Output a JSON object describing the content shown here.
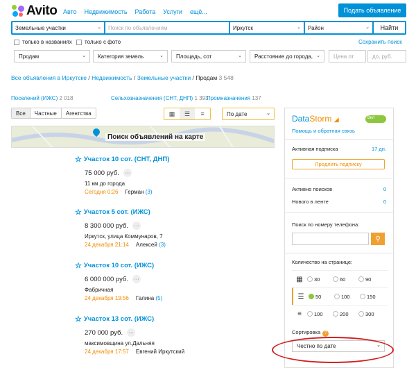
{
  "header": {
    "logo": "Avito",
    "nav": [
      "Авто",
      "Недвижимость",
      "Работа",
      "Услуги",
      "ещё..."
    ],
    "post_button": "Подать объявление"
  },
  "search": {
    "category": "Земельные участки",
    "query_placeholder": "Поиск по объявлениям",
    "city": "Иркутск",
    "district": "Район",
    "find_button": "Найти"
  },
  "checks": {
    "titles_only": "только в названиях",
    "with_photo": "только с фото",
    "save_search": "Сохранить поиск"
  },
  "filters": {
    "deal": "Продам",
    "land_category": "Категория земель",
    "area": "Площадь, сот",
    "distance": "Расстояние до города,",
    "price_from": "Цена от",
    "price_to": "до, руб."
  },
  "breadcrumb": {
    "p1": "Все объявления в Иркутске",
    "p2": "Недвижимость",
    "p3": "Земельные участки",
    "current": "Продам",
    "count": "3 548"
  },
  "categories": [
    {
      "label": "Поселений (ИЖС)",
      "count": "2 018"
    },
    {
      "label": "Сельхозназначения (СНТ, ДНП)",
      "count": "1 393"
    },
    {
      "label": "Промназначения",
      "count": "137"
    }
  ],
  "tabs": [
    "Все",
    "Частные",
    "Агентства"
  ],
  "sort": "По дате",
  "map_label": "Поиск объявлений на карте",
  "listings": [
    {
      "title": "Участок 10 сот. (СНТ, ДНП)",
      "price": "75 000 руб.",
      "addr": "11 км до города",
      "date": "Сегодня 0:26",
      "seller": "Герман",
      "n": "(3)"
    },
    {
      "title": "Участок 5 сот. (ИЖС)",
      "price": "8 300 000 руб.",
      "addr": "Иркутск, улица Коммунаров, 7",
      "date": "24 декабря 21:14",
      "seller": "Алексей",
      "n": "(3)"
    },
    {
      "title": "Участок 10 сот. (ИЖС)",
      "price": "6 000 000 руб.",
      "addr": "Фабричная",
      "date": "24 декабря 19:56",
      "seller": "Галина",
      "n": "(5)"
    },
    {
      "title": "Участок 13 сот. (ИЖС)",
      "price": "270 000 руб.",
      "addr": "максимовщина ул.Дальняя",
      "date": "24 декабря 17:57",
      "seller": "Евгений Иркутский",
      "n": ""
    }
  ],
  "panel": {
    "brand_a": "Data",
    "brand_b": "Storm",
    "toggle": "Вкл",
    "help": "Помощь и обратная связь",
    "sub_label": "Активная подписка",
    "sub_value": "17 дн.",
    "extend": "Продлить подписку",
    "active_label": "Активно поисков",
    "active_value": "0",
    "new_label": "Нового в ленте",
    "new_value": "0",
    "phone_label": "Поиск по номеру телефона:",
    "pp_label": "Количество на странице:",
    "pp_rows": [
      [
        "30",
        "60",
        "90"
      ],
      [
        "50",
        "100",
        "150"
      ],
      [
        "100",
        "200",
        "300"
      ]
    ],
    "sort_label": "Сортировка",
    "sort_value": "Честно по дате"
  },
  "colors": {
    "accent": "#0091d9",
    "orange": "#f08c00",
    "highlight": "#d02020"
  }
}
